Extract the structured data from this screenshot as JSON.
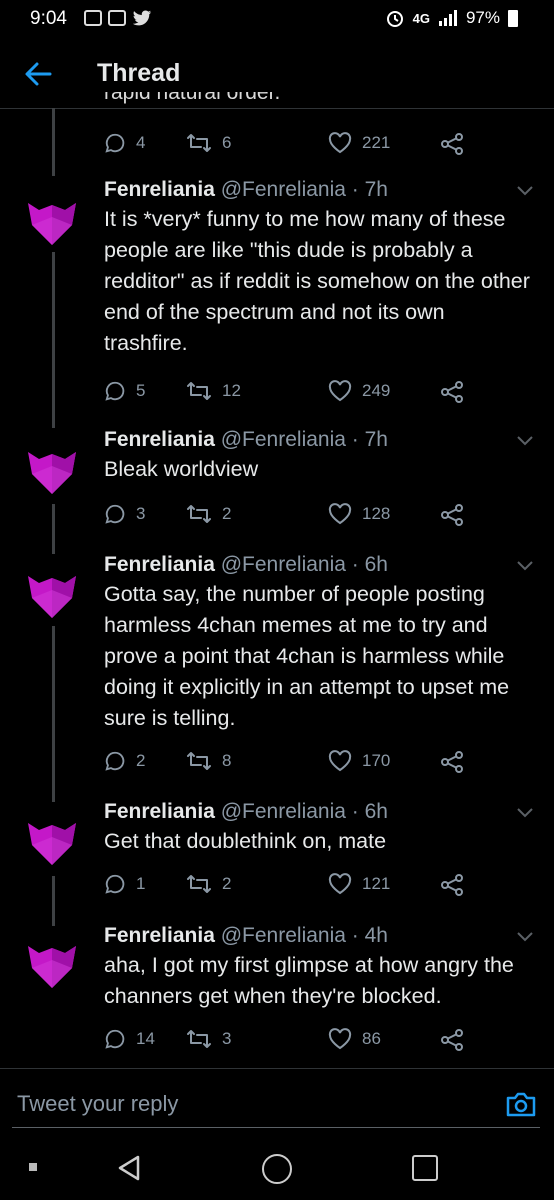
{
  "status_bar": {
    "time": "9:04",
    "network": "4G",
    "battery": "97%"
  },
  "header": {
    "title": "Thread"
  },
  "cutoff_text": "rapid natural order.",
  "top_actions": {
    "replies": "4",
    "retweets": "6",
    "likes": "221"
  },
  "tweets": [
    {
      "name": "Fenreliania",
      "handle": "@Fenreliania",
      "time": "· 7h",
      "text": "It is *very* funny to me how many of these people are like \"this dude is probably a redditor\" as if reddit is somehow on the other end of the spectrum and not its own trashfire.",
      "replies": "5",
      "retweets": "12",
      "likes": "249"
    },
    {
      "name": "Fenreliania",
      "handle": "@Fenreliania",
      "time": "· 7h",
      "text": "Bleak worldview",
      "replies": "3",
      "retweets": "2",
      "likes": "128"
    },
    {
      "name": "Fenreliania",
      "handle": "@Fenreliania",
      "time": "· 6h",
      "text": "Gotta say, the number of people posting harmless 4chan memes at me to try and prove a point that 4chan is harmless while doing it explicitly in an attempt to upset me sure is telling.",
      "replies": "2",
      "retweets": "8",
      "likes": "170"
    },
    {
      "name": "Fenreliania",
      "handle": "@Fenreliania",
      "time": "· 6h",
      "text": "Get that doublethink on, mate",
      "replies": "1",
      "retweets": "2",
      "likes": "121"
    },
    {
      "name": "Fenreliania",
      "handle": "@Fenreliania",
      "time": "· 4h",
      "text": "aha, I got my first glimpse at how angry the channers get when they're blocked.",
      "replies": "14",
      "retweets": "3",
      "likes": "86"
    }
  ],
  "reply": {
    "placeholder": "Tweet your reply"
  },
  "colors": {
    "accent": "#1d9bf0",
    "avatar": "#c418c8",
    "muted": "#8b98a5"
  }
}
